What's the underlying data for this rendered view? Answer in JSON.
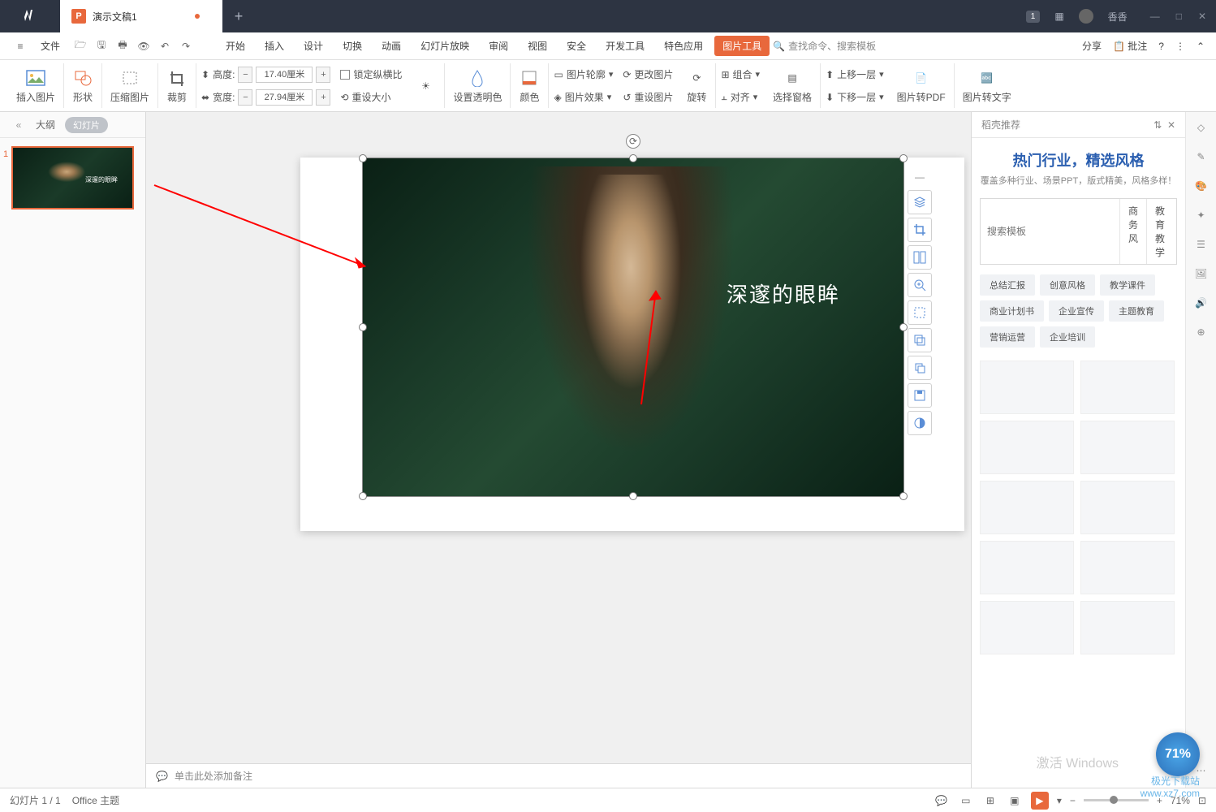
{
  "titlebar": {
    "tab_name": "演示文稿1",
    "user": "香香",
    "badge": "1"
  },
  "menu": {
    "file": "文件",
    "items": [
      "开始",
      "插入",
      "设计",
      "切换",
      "动画",
      "幻灯片放映",
      "审阅",
      "视图",
      "安全",
      "开发工具",
      "特色应用"
    ],
    "active": "图片工具",
    "search_ph": "查找命令、搜索模板",
    "share": "分享",
    "comment": "批注"
  },
  "ribbon": {
    "insert_pic": "插入图片",
    "shape": "形状",
    "compress": "压缩图片",
    "crop": "裁剪",
    "height_lbl": "高度:",
    "height_val": "17.40厘米",
    "width_lbl": "宽度:",
    "width_val": "27.94厘米",
    "lock": "锁定纵横比",
    "reset": "重设大小",
    "opacity": "设置透明色",
    "color": "颜色",
    "outline": "图片轮廓",
    "change": "更改图片",
    "effect": "图片效果",
    "reset2": "重设图片",
    "rotate": "旋转",
    "group": "组合",
    "align": "对齐",
    "pane": "选择窗格",
    "up": "上移一层",
    "down": "下移一层",
    "pdf": "图片转PDF",
    "text": "图片转文字"
  },
  "slidepanel": {
    "outline": "大纲",
    "slides": "幻灯片",
    "thumb_text": "深邃的眼眸",
    "num": "1"
  },
  "slide": {
    "text": "深邃的眼眸"
  },
  "notes": {
    "placeholder": "单击此处添加备注"
  },
  "rightpanel": {
    "head": "稻壳推荐",
    "title": "热门行业，精选风格",
    "sub": "覆盖多种行业、场景PPT，版式精美，风格多样！",
    "search_ph": "搜索模板",
    "chip1": "商务风",
    "chip2": "教育教学",
    "tags": [
      "总结汇报",
      "创意风格",
      "教学课件",
      "商业计划书",
      "企业宣传",
      "主题教育",
      "营销运营",
      "企业培训"
    ]
  },
  "status": {
    "slide": "幻灯片 1 / 1",
    "theme": "Office 主题",
    "zoom": "71%"
  },
  "badge_pct": "71%",
  "activate": "激活 Windows",
  "watermark": {
    "l1": "极光下载站",
    "l2": "www.xz7.com"
  }
}
